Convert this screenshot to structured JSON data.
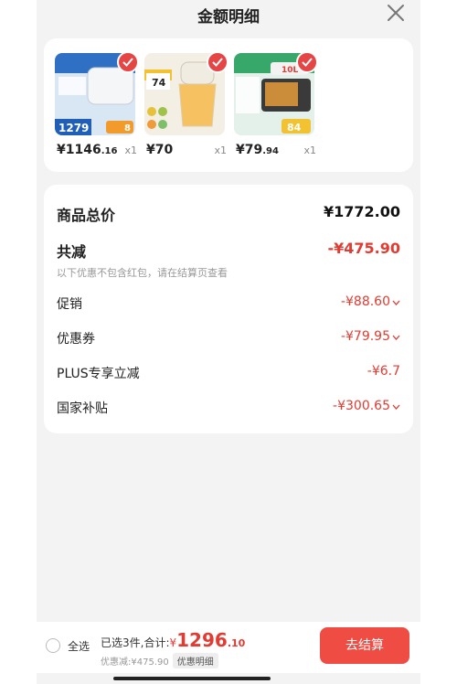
{
  "header": {
    "title": "金额明细"
  },
  "products": [
    {
      "price_main": "¥1146",
      "price_dec": ".16",
      "qty": "x1",
      "thumb_text": "1279",
      "thumb_tag": "8"
    },
    {
      "price_main": "¥70",
      "price_dec": "",
      "qty": "x1",
      "thumb_text": "74",
      "thumb_tag": ""
    },
    {
      "price_main": "¥79",
      "price_dec": ".94",
      "qty": "x1",
      "thumb_text": "84",
      "thumb_tag": "10L"
    }
  ],
  "summary": {
    "total_label": "商品总价",
    "total_value": "¥1772.00",
    "discount_label": "共减",
    "discount_value": "-¥475.90",
    "note": "以下优惠不包含红包，请在结算页查看",
    "items": [
      {
        "label": "促销",
        "value": "-¥88.60"
      },
      {
        "label": "优惠券",
        "value": "-¥79.95"
      },
      {
        "label": "PLUS专享立减",
        "value": "-¥6.7"
      },
      {
        "label": "国家补贴",
        "value": "-¥300.65"
      }
    ]
  },
  "bottom": {
    "select_all": "全选",
    "summary_prefix": "已选3件,合计:",
    "currency": "¥",
    "amount_main": "1296",
    "amount_dec": ".10",
    "discount_text": "优惠减:¥475.90",
    "detail_tag": "优惠明细",
    "checkout_label": "去结算"
  },
  "colors": {
    "accent": "#e23b32",
    "button": "#ef4c43"
  }
}
